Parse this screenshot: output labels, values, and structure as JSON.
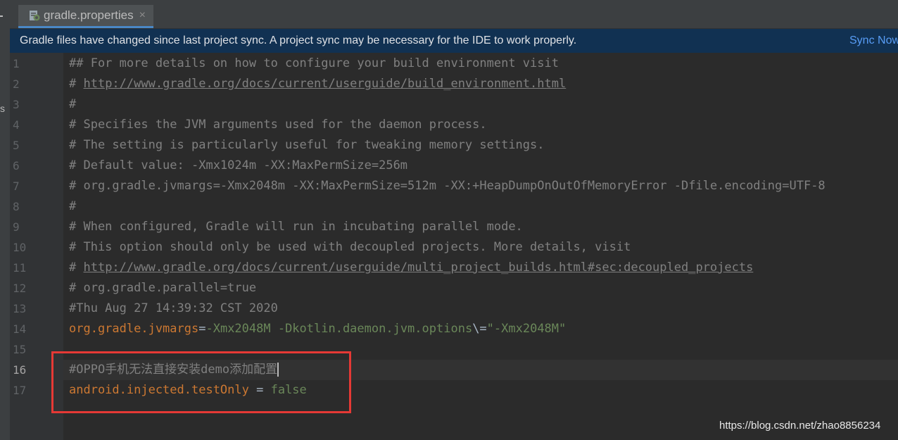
{
  "tab": {
    "label": "gradle.properties",
    "close": "×"
  },
  "left_strip": {
    "char": "s"
  },
  "banner": {
    "message": "Gradle files have changed since last project sync. A project sync may be necessary for the IDE to work properly.",
    "link": "Sync Now"
  },
  "editor": {
    "active_line": 16,
    "line_numbers": [
      "1",
      "2",
      "3",
      "4",
      "5",
      "6",
      "7",
      "8",
      "9",
      "10",
      "11",
      "12",
      "13",
      "14",
      "15",
      "16",
      "17"
    ],
    "lines": [
      [
        {
          "t": "## For more details on how to configure your build environment visit",
          "k": "cm"
        }
      ],
      [
        {
          "t": "# ",
          "k": "cm"
        },
        {
          "t": "http://www.gradle.org/docs/current/userguide/build_environment.html",
          "k": "url"
        }
      ],
      [
        {
          "t": "#",
          "k": "cm"
        }
      ],
      [
        {
          "t": "# Specifies the JVM arguments used for the daemon process.",
          "k": "cm"
        }
      ],
      [
        {
          "t": "# The setting is particularly useful for tweaking memory settings.",
          "k": "cm"
        }
      ],
      [
        {
          "t": "# Default value: -Xmx1024m -XX:MaxPermSize=256m",
          "k": "cm"
        }
      ],
      [
        {
          "t": "# org.gradle.jvmargs=-Xmx2048m -XX:MaxPermSize=512m -XX:+HeapDumpOnOutOfMemoryError -Dfile.encoding=UTF-8",
          "k": "cm"
        }
      ],
      [
        {
          "t": "#",
          "k": "cm"
        }
      ],
      [
        {
          "t": "# When configured, Gradle will run in incubating parallel mode.",
          "k": "cm"
        }
      ],
      [
        {
          "t": "# This option should only be used with decoupled projects. More details, visit",
          "k": "cm"
        }
      ],
      [
        {
          "t": "# ",
          "k": "cm"
        },
        {
          "t": "http://www.gradle.org/docs/current/userguide/multi_project_builds.html#sec:decoupled_projects",
          "k": "url"
        }
      ],
      [
        {
          "t": "# org.gradle.parallel=true",
          "k": "cm"
        }
      ],
      [
        {
          "t": "#Thu Aug 27 14:39:32 CST 2020",
          "k": "cm"
        }
      ],
      [
        {
          "t": "org.gradle.jvmargs",
          "k": "key"
        },
        {
          "t": "=",
          "k": "op"
        },
        {
          "t": "-Xmx2048M -Dkotlin.daemon.jvm.options",
          "k": "val"
        },
        {
          "t": "\\=",
          "k": "op"
        },
        {
          "t": "\"-Xmx2048M\"",
          "k": "val"
        }
      ],
      [],
      [
        {
          "t": "#OPPO手机无法直接安装demo添加配置",
          "k": "cm"
        }
      ],
      [
        {
          "t": "android.injected.testOnly",
          "k": "key"
        },
        {
          "t": " = ",
          "k": "op"
        },
        {
          "t": "false",
          "k": "val"
        }
      ]
    ]
  },
  "watermark": "https://blog.csdn.net/zhao8856234",
  "colors": {
    "comment": "#808080",
    "key": "#cc7832",
    "value": "#6a8759",
    "highlight_box": "#e53935",
    "banner_bg": "#113152",
    "link": "#589df6"
  }
}
